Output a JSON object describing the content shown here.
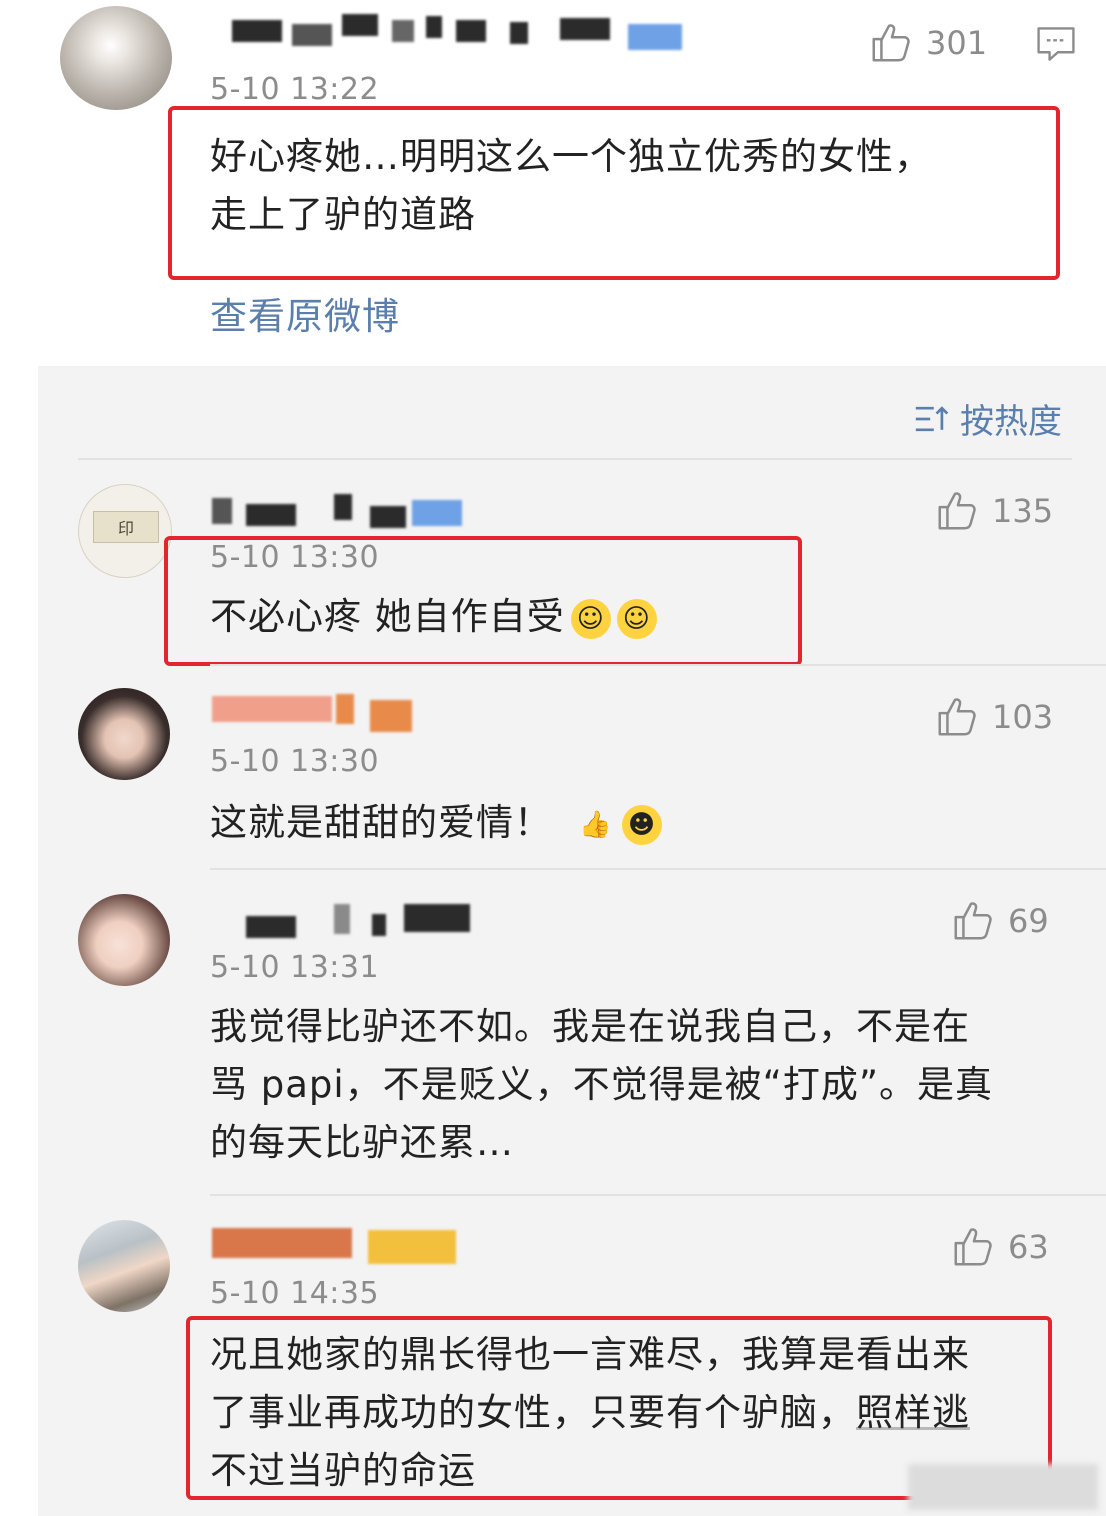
{
  "main_post": {
    "timestamp": "5-10 13:22",
    "likes": "301",
    "text_line1": "好心疼她…明明这么一个独立优秀的女性，",
    "text_line2": "走上了驴的道路",
    "view_original_label": "查看原微博"
  },
  "replies_header": {
    "sort_label": "按热度",
    "sort_icon": "sort-icon"
  },
  "replies": [
    {
      "timestamp": "5-10 13:30",
      "likes": "135",
      "text": "不必心疼 她自作自受"
    },
    {
      "timestamp": "5-10 13:30",
      "likes": "103",
      "text": "这就是甜甜的爱情！"
    },
    {
      "timestamp": "5-10 13:31",
      "likes": "69",
      "text_line1": "我觉得比驴还不如。我是在说我自己，不是在",
      "text_line2": "骂 papi，不是贬义，不觉得是被“打成”。是真",
      "text_line3": "的每天比驴还累…"
    },
    {
      "timestamp": "5-10 14:35",
      "likes": "63",
      "text_line1": "况且她家的鼎长得也一言难尽，我算是看出来",
      "text_line2a": "了事业再成功的女性，只要有个驴脑，",
      "text_line2b": "照样逃",
      "text_line3": "不过当驴的命运"
    }
  ],
  "colors": {
    "highlight_box": "#e3262d",
    "link": "#5b7fad",
    "meta_text": "#8c8c8c",
    "panel_bg": "#f3f3f3"
  }
}
